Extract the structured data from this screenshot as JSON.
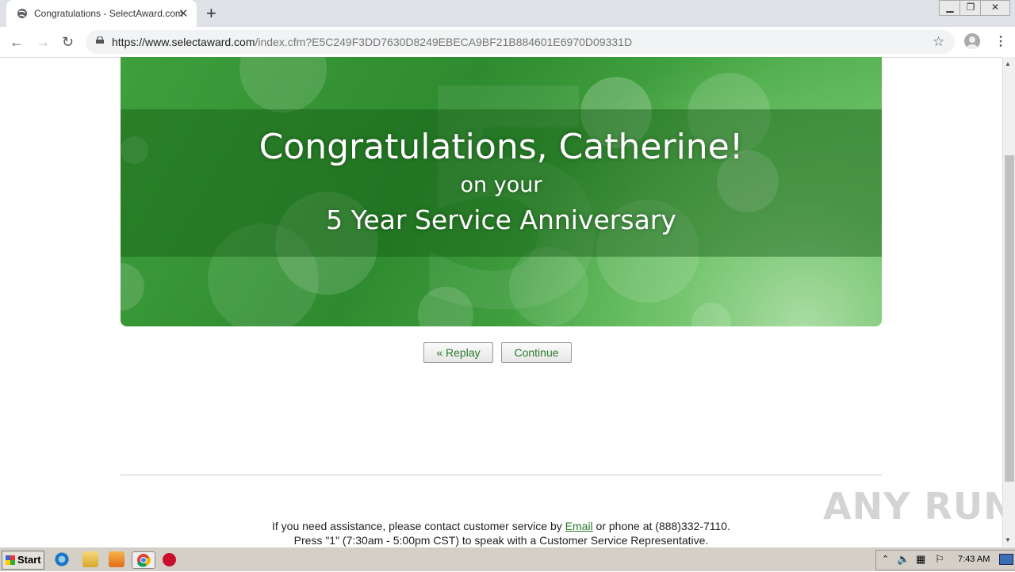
{
  "browser": {
    "tab_title": "Congratulations - SelectAward.com",
    "new_tab": "+",
    "url_domain": "https://www.selectaward.com",
    "url_path": "/index.cfm?E5C249F3DD7630D8249EBECA9BF21B884601E6970D09331D"
  },
  "banner": {
    "headline": "Congratulations, Catherine!",
    "subline": "on your",
    "milestone": "5 Year Service Anniversary"
  },
  "actions": {
    "replay_label": "« Replay",
    "continue_label": "Continue"
  },
  "footer": {
    "line1_pre": "If you need assistance, please contact customer service by ",
    "email_link": "Email",
    "line1_post": " or phone at (888)332-7110.",
    "line2": "Press \"1\" (7:30am - 5:00pm CST) to speak with a Customer Service Representative."
  },
  "watermark": "ANY RUN",
  "taskbar": {
    "start_label": "Start",
    "clock": "7:43 AM"
  }
}
